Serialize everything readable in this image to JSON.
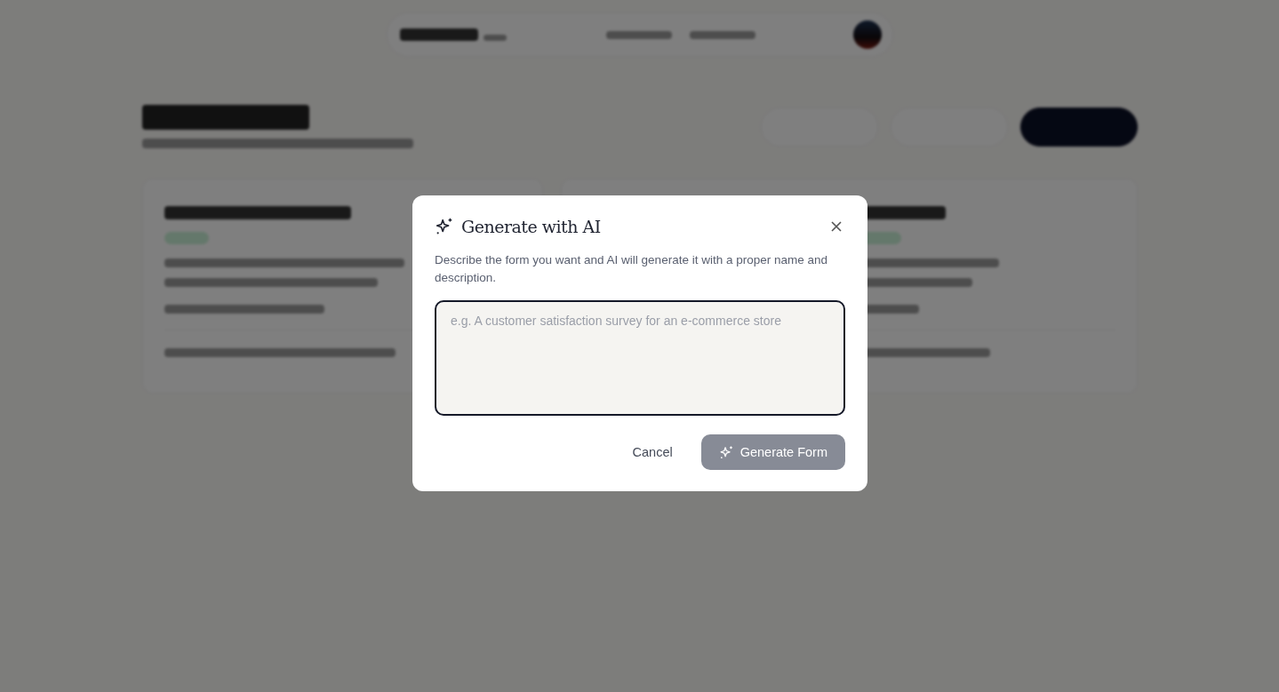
{
  "dialog": {
    "title": "Generate with AI",
    "description": "Describe the form you want and AI will generate it with a proper name and description.",
    "placeholder": "e.g. A customer satisfaction survey for an e-commerce store",
    "cancel": "Cancel",
    "submit": "Generate Form",
    "submit_disabled": true
  }
}
